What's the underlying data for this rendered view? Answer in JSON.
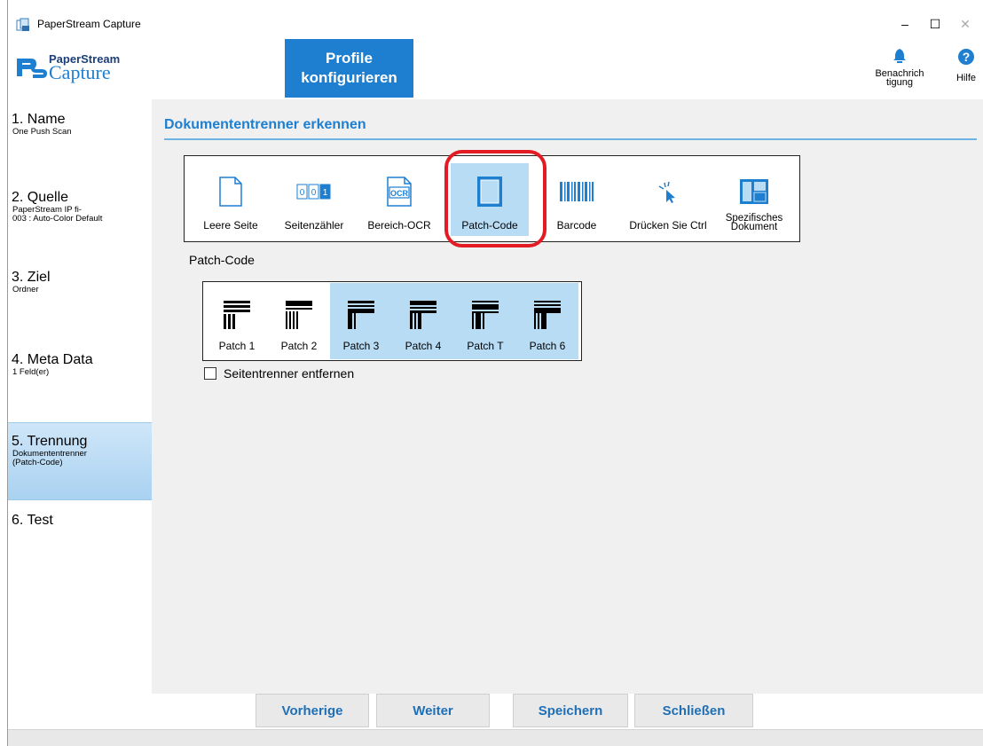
{
  "window": {
    "title": "PaperStream Capture",
    "minimize": "–",
    "maximize": "☐",
    "close": "✕"
  },
  "header": {
    "logo_top": "PaperStream",
    "logo_bottom": "Capture",
    "active_tab_line1": "Profile",
    "active_tab_line2": "konfigurieren",
    "notify_label_1": "Benachrich",
    "notify_label_2": "tigung",
    "help_label": "Hilfe"
  },
  "sidebar": {
    "items": [
      {
        "title": "1. Name",
        "sub": [
          "One Push Scan"
        ]
      },
      {
        "title": "2. Quelle",
        "sub": [
          "PaperStream IP fi-",
          "003 : Auto-Color Default"
        ]
      },
      {
        "title": "3. Ziel",
        "sub": [
          "Ordner"
        ]
      },
      {
        "title": "4. Meta Data",
        "sub": [
          "1 Feld(er)"
        ]
      },
      {
        "title": "5. Trennung",
        "sub": [
          "Dokumententrenner",
          "(Patch-Code)"
        ]
      },
      {
        "title": "6. Test",
        "sub": []
      }
    ],
    "active_index": 4
  },
  "main": {
    "section_title": "Dokumententrenner erkennen",
    "separators": [
      {
        "label": "Leere Seite",
        "icon": "blank-page-icon"
      },
      {
        "label": "Seitenzähler",
        "icon": "page-counter-icon"
      },
      {
        "label": "Bereich-OCR",
        "icon": "ocr-icon"
      },
      {
        "label": "Patch-Code",
        "icon": "patch-code-icon",
        "selected": true
      },
      {
        "label": "Barcode",
        "icon": "barcode-icon"
      },
      {
        "label": "Drücken Sie Ctrl",
        "icon": "click-icon"
      },
      {
        "label_line1": "Spezifisches",
        "label_line2": "Dokument",
        "icon": "document-layout-icon"
      }
    ],
    "ocr_text": "OCR",
    "counter_text": "0 0 1",
    "patch_caption": "Patch-Code",
    "patches": [
      "Patch 1",
      "Patch 2",
      "Patch 3",
      "Patch 4",
      "Patch T",
      "Patch 6"
    ],
    "checkbox_label": "Seitentrenner entfernen",
    "checkbox_checked": false
  },
  "footer": {
    "prev": "Vorherige",
    "next": "Weiter",
    "save": "Speichern",
    "close": "Schließen"
  },
  "colors": {
    "accent": "#1e7fd0",
    "selection": "#b9dcf5",
    "highlight_ring": "#e31b23"
  }
}
